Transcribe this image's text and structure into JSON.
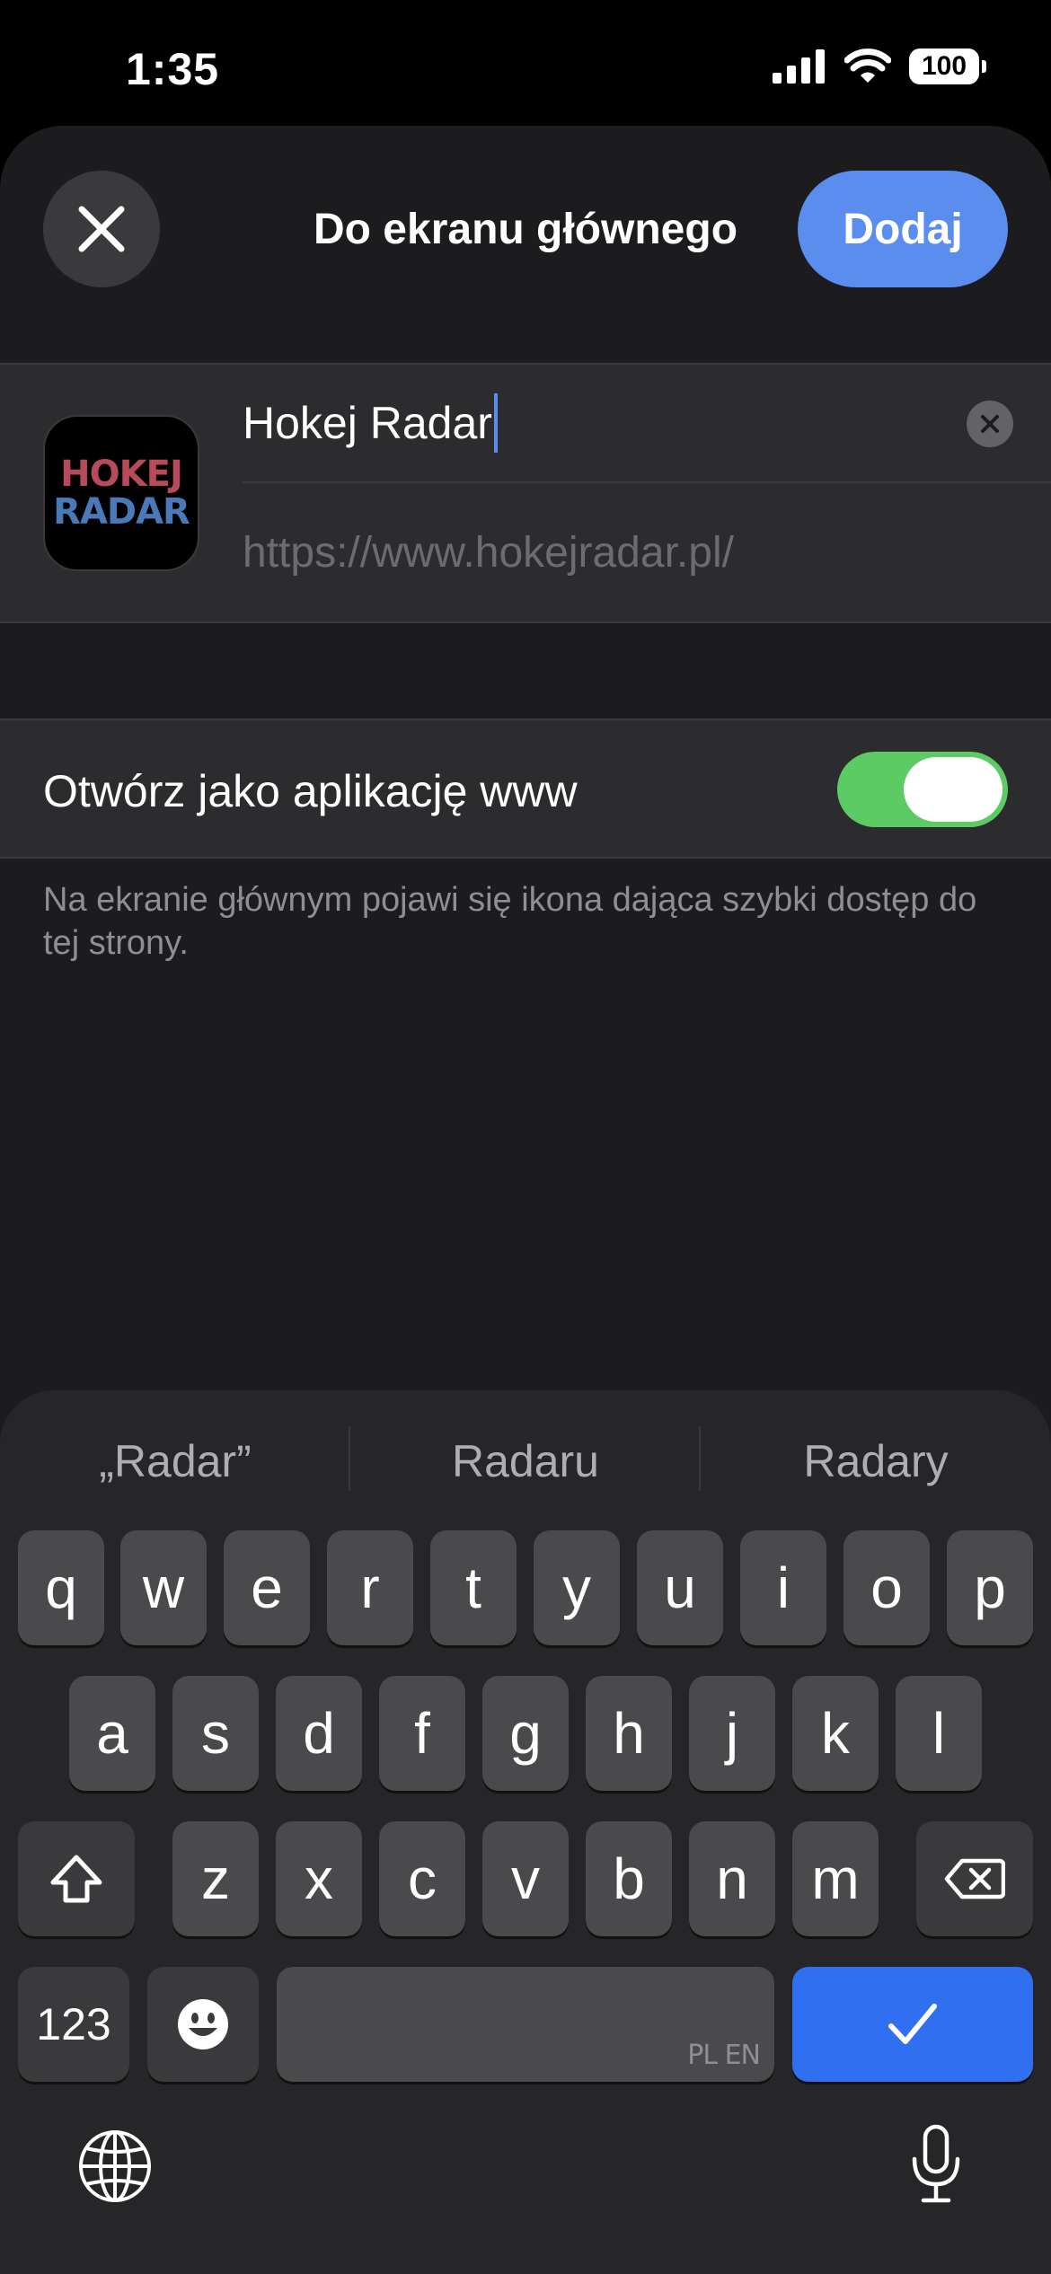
{
  "status_bar": {
    "time": "1:35",
    "battery": "100"
  },
  "sheet": {
    "title": "Do ekranu głównego",
    "add_label": "Dodaj",
    "app_icon": {
      "line1": "HOKEJ",
      "line2": "RADAR"
    },
    "name_value": "Hokej Radar",
    "url": "https://www.hokejradar.pl/",
    "toggle_label": "Otwórz jako aplikację www",
    "toggle_on": true,
    "footnote": "Na ekranie głównym pojawi się ikona dająca szybki dostęp do tej strony."
  },
  "keyboard": {
    "suggestions": [
      "„Radar”",
      "Radaru",
      "Radary"
    ],
    "row1": [
      "q",
      "w",
      "e",
      "r",
      "t",
      "y",
      "u",
      "i",
      "o",
      "p"
    ],
    "row2": [
      "a",
      "s",
      "d",
      "f",
      "g",
      "h",
      "j",
      "k",
      "l"
    ],
    "row3": [
      "z",
      "x",
      "c",
      "v",
      "b",
      "n",
      "m"
    ],
    "numbers_label": "123",
    "space_lang": "PL EN"
  },
  "colors": {
    "accent": "#5b8def",
    "toggle_on": "#5dcb64",
    "return_key": "#2f6ff0"
  }
}
